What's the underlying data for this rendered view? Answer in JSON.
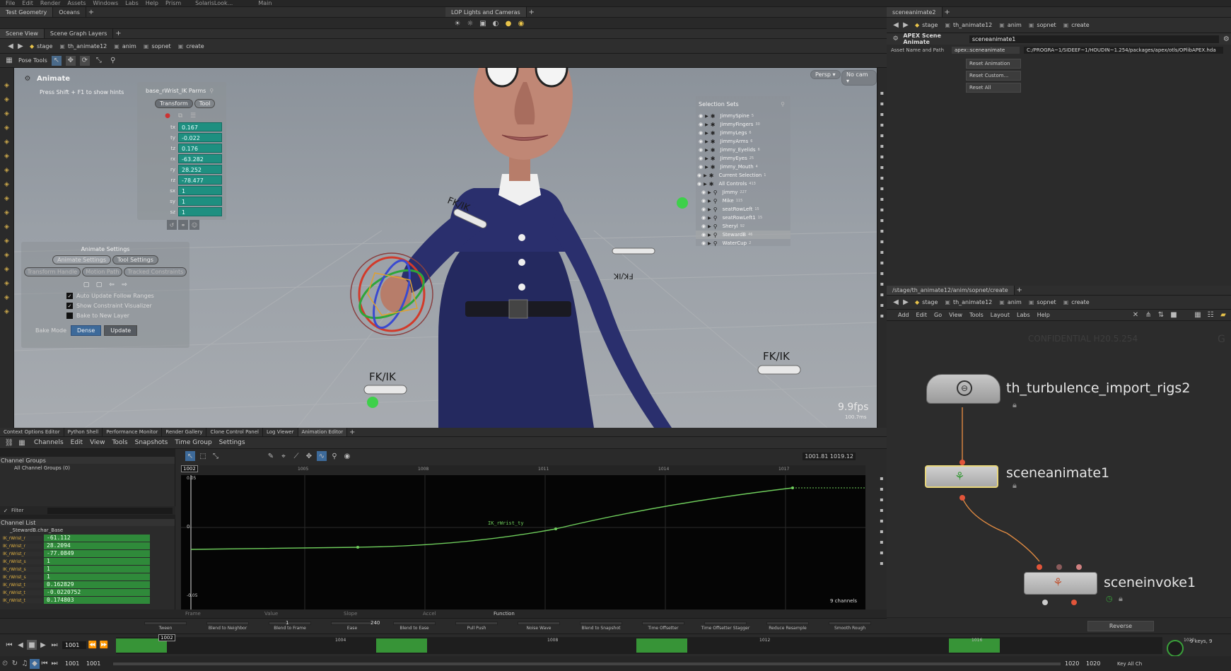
{
  "menubar": {
    "items": [
      "File",
      "Edit",
      "Render",
      "Assets",
      "Windows",
      "Labs",
      "Help",
      "Prism"
    ],
    "desktop": "SolarisLook...",
    "main": "Main"
  },
  "topleft_tabs": [
    "Test Geometry",
    "Oceans"
  ],
  "topmid_tabs": [
    "LOP Lights and Cameras"
  ],
  "viewer_tabs": [
    "Scene View",
    "Scene Graph Layers"
  ],
  "path": [
    "stage",
    "th_animate12",
    "anim",
    "sopnet",
    "create"
  ],
  "pose_tools": "Pose Tools",
  "viewport": {
    "animate_title": "Animate",
    "hint_text": "Press Shift + F1 to show hints",
    "persp": "Persp ▾",
    "cam": "No cam ▾",
    "fps": "9.9fps",
    "ms": "100.7ms",
    "fkik": [
      "FK/IK",
      "FK/IK",
      "FK/IK",
      "FK/IK"
    ]
  },
  "parms": {
    "title": "base_rWrist_IK Parms",
    "tab_transform": "Transform",
    "tab_tool": "Tool",
    "rows": [
      {
        "k": "tx",
        "v": "0.167"
      },
      {
        "k": "ty",
        "v": "-0.022"
      },
      {
        "k": "tz",
        "v": "0.176"
      },
      {
        "k": "rx",
        "v": "-63.282"
      },
      {
        "k": "ry",
        "v": "28.252"
      },
      {
        "k": "rz",
        "v": "-78.477"
      },
      {
        "k": "sx",
        "v": "1"
      },
      {
        "k": "sy",
        "v": "1"
      },
      {
        "k": "sz",
        "v": "1"
      }
    ]
  },
  "animate_settings": {
    "title": "Animate Settings",
    "tabs": [
      "Animate Settings",
      "Tool Settings"
    ],
    "subtabs": [
      "Transform Handle",
      "Motion Path",
      "Tracked Constraints"
    ],
    "checks": [
      {
        "label": "Auto Update Follow Ranges",
        "on": true
      },
      {
        "label": "Show Constraint Visualizer",
        "on": true
      },
      {
        "label": "Bake to New Layer",
        "on": false
      }
    ],
    "bake_mode": "Bake Mode",
    "dense": "Dense",
    "update": "Update"
  },
  "selection_sets": {
    "title": "Selection Sets",
    "items": [
      {
        "name": "JimmySpine",
        "n": "5"
      },
      {
        "name": "JimmyFingers",
        "n": "30"
      },
      {
        "name": "JimmyLegs",
        "n": "6"
      },
      {
        "name": "JimmyArms",
        "n": "6"
      },
      {
        "name": "Jimmy_Eyelids",
        "n": "6"
      },
      {
        "name": "JimmyEyes",
        "n": "25"
      },
      {
        "name": "Jimmy_Mouth",
        "n": "4"
      },
      {
        "name": "Current Selection",
        "n": "1"
      },
      {
        "name": "All Controls",
        "n": "413"
      },
      {
        "name": "Jimmy",
        "n": "227"
      },
      {
        "name": "Mike",
        "n": "115"
      },
      {
        "name": "seatRowLeft",
        "n": "15"
      },
      {
        "name": "seatRowLeft1",
        "n": "15"
      },
      {
        "name": "Sheryl",
        "n": "92"
      },
      {
        "name": "StewardB",
        "n": "46"
      },
      {
        "name": "WaterCup",
        "n": "2"
      }
    ]
  },
  "bottom_tabs": [
    "Context Options Editor",
    "Python Shell",
    "Performance Monitor",
    "Render Gallery",
    "Clone Control Panel",
    "Log Viewer",
    "Animation Editor"
  ],
  "anim_menu": [
    "Channels",
    "Edit",
    "View",
    "Tools",
    "Snapshots",
    "Time Group",
    "Settings"
  ],
  "channel_groups": {
    "title": "Channel Groups",
    "item": "All Channel Groups (0)"
  },
  "filter": "Filter",
  "channel_list": {
    "title": "Channel List",
    "root": "_StewardB.char_Base",
    "rows": [
      {
        "n": "IK_rWrist_r",
        "v": "-61.112"
      },
      {
        "n": "IK_rWrist_r",
        "v": "28.2094"
      },
      {
        "n": "IK_rWrist_r",
        "v": "-77.0849"
      },
      {
        "n": "IK_rWrist_s",
        "v": "1"
      },
      {
        "n": "IK_rWrist_s",
        "v": "1"
      },
      {
        "n": "IK_rWrist_s",
        "v": "1"
      },
      {
        "n": "IK_rWrist_t",
        "v": "0.162829"
      },
      {
        "n": "IK_rWrist_t",
        "v": "-0.0220752"
      },
      {
        "n": "IK_rWrist_t",
        "v": "0.174803"
      }
    ]
  },
  "graph": {
    "range": "1001.81 1019.12",
    "frame_marker": "1002",
    "ticks": [
      "1005",
      "1008",
      "1011",
      "1014",
      "1017"
    ],
    "y_top": "0.05",
    "y_zero": "0",
    "y_bottom": "-0.05",
    "curve_label": "IK_rWrist_ty",
    "channels": "9 channels"
  },
  "key_fields": [
    "Frame",
    "Value",
    "Slope",
    "Accel",
    "Function"
  ],
  "blend_tools": [
    "Tween",
    "Blend to Neighbor",
    "Blend to Frame",
    "Ease",
    "Blend to Ease",
    "Pull Push",
    "Noise Wave",
    "Blend to Snapshot",
    "Time Offsetter",
    "Time Offsetter Stagger",
    "Reduce Resample",
    "Smooth Rough"
  ],
  "blend_vals": {
    "a": "1",
    "b": "240"
  },
  "reverse": "Reverse",
  "timeline": {
    "frame": "1001",
    "start": "1001",
    "start2": "1001",
    "end": "1020",
    "end2": "1020",
    "cursor": "1002",
    "ticks": [
      "1004",
      "1008",
      "1012",
      "1016",
      "1020"
    ],
    "keys_label": "9 keys, 9",
    "key_all": "Key All Ch"
  },
  "right_top": {
    "tab": "sceneanimate2",
    "asset_tag": "APEX Scene Animate",
    "asset_name": "sceneanimate1",
    "asset_label": "Asset Name and Path",
    "asset_type": "apex::sceneanimate",
    "asset_path": "C:/PROGRA~1/SIDEEF~1/HOUDIN~1.254/packages/apex/otls/OPlibAPEX.hda",
    "buttons": [
      "Reset Animation",
      "Reset Custom...",
      "Reset All"
    ]
  },
  "network": {
    "tab": "/stage/th_animate12/anim/sopnet/create",
    "menu": [
      "Add",
      "Edit",
      "Go",
      "View",
      "Tools",
      "Layout",
      "Labs",
      "Help"
    ],
    "watermark": "CONFIDENTIAL H20.5.254",
    "nodes": [
      {
        "name": "th_turbulence_import_rigs2"
      },
      {
        "name": "sceneanimate1"
      },
      {
        "name": "sceneinvoke1"
      }
    ]
  },
  "colors": {
    "teal": "#1e8f80",
    "green": "#2f8a3a",
    "curve": "#6fce5c",
    "node_sel": "#e8d67a",
    "wire": "#e08a42",
    "port": "#e2553a"
  }
}
